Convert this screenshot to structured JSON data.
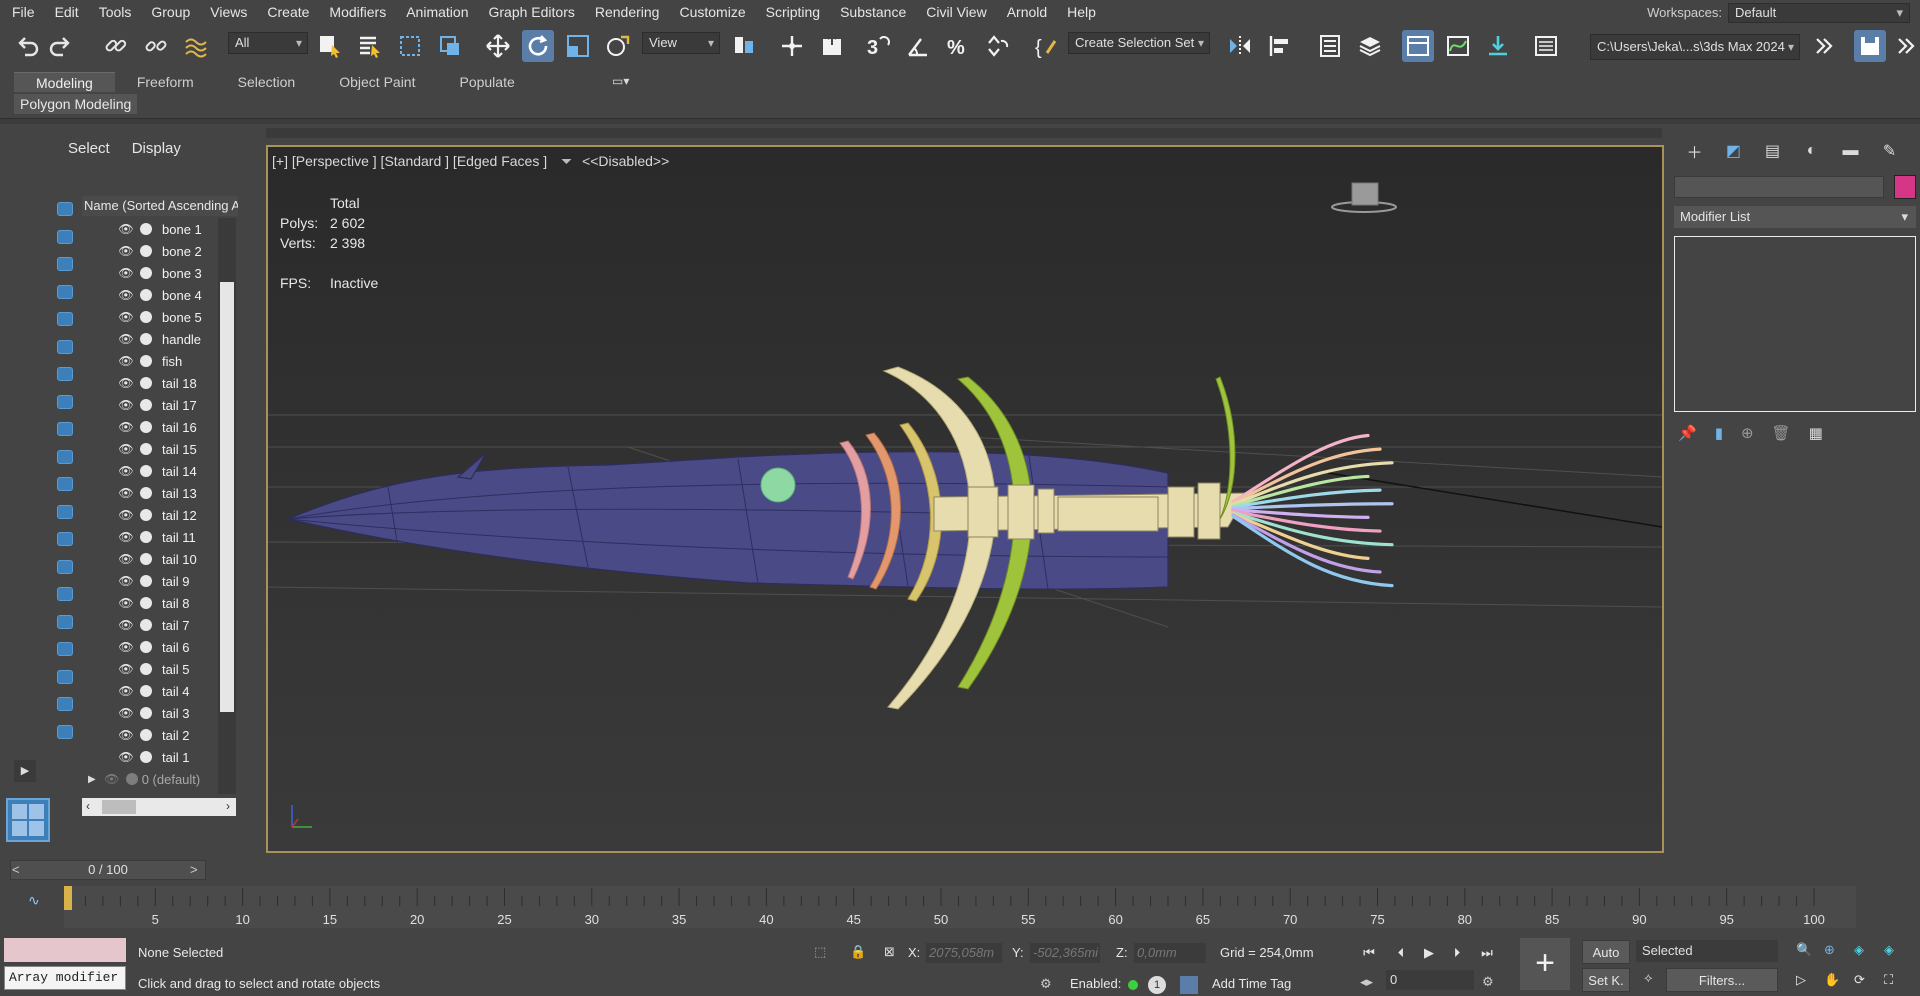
{
  "menus": [
    "File",
    "Edit",
    "Tools",
    "Group",
    "Views",
    "Create",
    "Modifiers",
    "Animation",
    "Graph Editors",
    "Rendering",
    "Customize",
    "Scripting",
    "Substance",
    "Civil View",
    "Arnold",
    "Help"
  ],
  "workspace": {
    "label": "Workspaces:",
    "value": "Default"
  },
  "toolbar": {
    "filter": "All",
    "ref_coord": "View",
    "selection_set": "Create Selection Set",
    "project_path": "C:\\Users\\Jeka\\...s\\3ds Max 2024"
  },
  "ribbon": {
    "tabs": [
      "Modeling",
      "Freeform",
      "Selection",
      "Object Paint",
      "Populate"
    ],
    "active_tab": "Modeling",
    "subtab": "Polygon Modeling"
  },
  "scene_explorer": {
    "tabs": [
      "Select",
      "Display"
    ],
    "header": "Name (Sorted Ascending A",
    "items": [
      "bone 1",
      "bone 2",
      "bone 3",
      "bone 4",
      "bone 5",
      "handle",
      "fish",
      "tail 18",
      "tail 17",
      "tail 16",
      "tail 15",
      "tail 14",
      "tail 13",
      "tail 12",
      "tail 11",
      "tail 10",
      "tail 9",
      "tail 8",
      "tail 7",
      "tail 6",
      "tail 5",
      "tail 4",
      "tail 3",
      "tail 2",
      "tail 1"
    ],
    "layer": "0 (default)"
  },
  "viewport": {
    "label": "[+] [Perspective ] [Standard ] [Edged Faces ]",
    "filter_text": "<<Disabled>>",
    "stats_header": "Total",
    "polys_label": "Polys:",
    "polys": "2 602",
    "verts_label": "Verts:",
    "verts": "2 398",
    "fps_label": "FPS:",
    "fps": "Inactive",
    "colors": {
      "blade": "#4a4a86",
      "bone": "#e6dcae",
      "green": "#9fc43c",
      "gold": "#d9c46e"
    }
  },
  "command_panel": {
    "modifier_list": "Modifier List",
    "object_color": "#d53786"
  },
  "timeline": {
    "frame": "0 / 100",
    "ticks": [
      "5",
      "10",
      "15",
      "20",
      "25",
      "30",
      "35",
      "40",
      "45",
      "50",
      "55",
      "60",
      "65",
      "70",
      "75",
      "80",
      "85",
      "90",
      "95",
      "100"
    ]
  },
  "status": {
    "maxscript": "Array modifier",
    "selection": "None Selected",
    "prompt": "Click and drag to select and rotate objects",
    "x_label": "X:",
    "x": "2075,058m",
    "y_label": "Y:",
    "y": "-502,365mi",
    "z_label": "Z:",
    "z": "0,0mm",
    "grid": "Grid = 254,0mm",
    "enabled": "Enabled:",
    "add_time_tag": "Add Time Tag",
    "auto": "Auto",
    "set_key": "Set K.",
    "key_mode": "Selected",
    "filters": "Filters...",
    "current_frame": "0"
  }
}
